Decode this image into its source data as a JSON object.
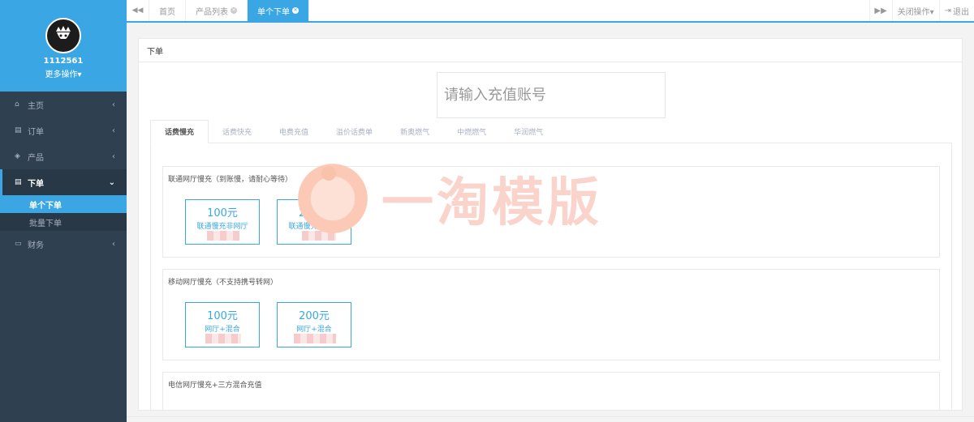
{
  "sidebar": {
    "user_id": "1112561",
    "more_ops": "更多操作▾",
    "items": [
      {
        "label": "主页",
        "icon": "home-icon",
        "glyph": "⌂"
      },
      {
        "label": "订单",
        "icon": "file-icon",
        "glyph": "▤"
      },
      {
        "label": "产品",
        "icon": "cube-icon",
        "glyph": "◈"
      },
      {
        "label": "下单",
        "icon": "edit-icon",
        "glyph": "▤"
      },
      {
        "label": "财务",
        "icon": "money-icon",
        "glyph": "▭"
      }
    ],
    "sub_items": [
      {
        "label": "单个下单"
      },
      {
        "label": "批量下单"
      }
    ]
  },
  "topbar": {
    "tabs": [
      {
        "label": "首页"
      },
      {
        "label": "产品列表"
      },
      {
        "label": "单个下单"
      }
    ],
    "close_ops": "关闭操作▾",
    "logout": "退出"
  },
  "panel": {
    "title": "下单",
    "account_placeholder": "请输入充值账号",
    "categories": [
      "话费慢充",
      "话费快充",
      "电费充值",
      "溢价话费单",
      "新奥燃气",
      "中燃燃气",
      "华润燃气"
    ],
    "groups": [
      {
        "title": "联通网厅慢充（到账慢，请耐心等待）",
        "packages": [
          {
            "price": "100元",
            "desc": "联通慢充非网厅"
          },
          {
            "price": "200元",
            "desc": "联通慢充非网厅"
          }
        ]
      },
      {
        "title": "移动网厅慢充（不支持携号转网）",
        "packages": [
          {
            "price": "100元",
            "desc": "网厅+混合"
          },
          {
            "price": "200元",
            "desc": "网厅+混合"
          }
        ]
      },
      {
        "title": "电信网厅慢充+三方混合充值",
        "packages": []
      }
    ]
  },
  "watermark": {
    "text": "一淘模版"
  },
  "colors": {
    "accent": "#3aa7e4",
    "sidebar": "#2f4050"
  }
}
